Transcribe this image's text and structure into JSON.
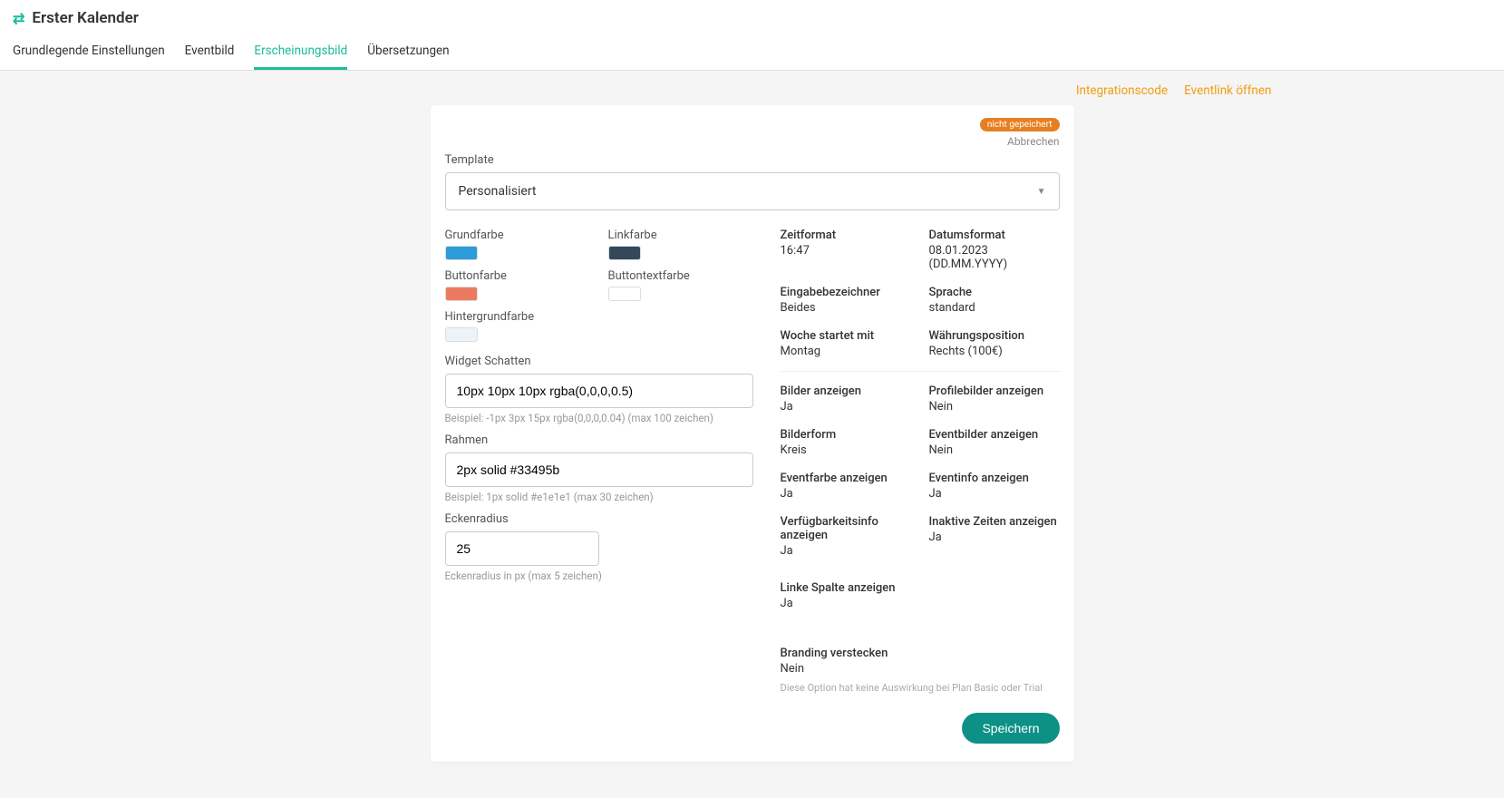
{
  "header": {
    "title": "Erster Kalender"
  },
  "tabs": [
    {
      "label": "Grundlegende Einstellungen",
      "active": false
    },
    {
      "label": "Eventbild",
      "active": false
    },
    {
      "label": "Erscheinungsbild",
      "active": true
    },
    {
      "label": "Übersetzungen",
      "active": false
    }
  ],
  "topLinks": {
    "integration": "Integrationscode",
    "eventlink": "Eventlink öffnen"
  },
  "card": {
    "badge": "nicht gepeichert",
    "cancel": "Abbrechen",
    "templateLabel": "Template",
    "templateValue": "Personalisiert",
    "colors": {
      "grund": {
        "label": "Grundfarbe",
        "hex": "#2D9CDB"
      },
      "link": {
        "label": "Linkfarbe",
        "hex": "#33495b"
      },
      "button": {
        "label": "Buttonfarbe",
        "hex": "#EB7A5E"
      },
      "buttontext": {
        "label": "Buttontextfarbe",
        "hex": "#FFFFFF"
      },
      "hintergrund": {
        "label": "Hintergrundfarbe",
        "hex": "#EDF3F7"
      }
    },
    "widgetShadow": {
      "label": "Widget Schatten",
      "value": "10px 10px 10px rgba(0,0,0,0.5)",
      "hint": "Beispiel: -1px 3px 15px rgba(0,0,0,0.04) (max 100 zeichen)"
    },
    "border": {
      "label": "Rahmen",
      "value": "2px solid #33495b",
      "hint": "Beispiel: 1px solid #e1e1e1 (max 30 zeichen)"
    },
    "radius": {
      "label": "Eckenradius",
      "value": "25",
      "hint": "Eckenradius in px (max 5 zeichen)"
    },
    "settingsA": [
      {
        "label": "Zeitformat",
        "value": "16:47"
      },
      {
        "label": "Datumsformat",
        "value": "08.01.2023 (DD.MM.YYYY)"
      },
      {
        "label": "Eingabebezeichner",
        "value": "Beides"
      },
      {
        "label": "Sprache",
        "value": "standard"
      },
      {
        "label": "Woche startet mit",
        "value": "Montag"
      },
      {
        "label": "Währungsposition",
        "value": "Rechts (100€)"
      }
    ],
    "settingsB": [
      {
        "label": "Bilder anzeigen",
        "value": "Ja"
      },
      {
        "label": "Profilebilder anzeigen",
        "value": "Nein"
      },
      {
        "label": "Bilderform",
        "value": "Kreis"
      },
      {
        "label": "Eventbilder anzeigen",
        "value": "Nein"
      },
      {
        "label": "Eventfarbe anzeigen",
        "value": "Ja"
      },
      {
        "label": "Eventinfo anzeigen",
        "value": "Ja"
      },
      {
        "label": "Verfügbarkeitsinfo anzeigen",
        "value": "Ja"
      },
      {
        "label": "Inaktive Zeiten anzeigen",
        "value": "Ja"
      }
    ],
    "settingsC": [
      {
        "label": "Linke Spalte anzeigen",
        "value": "Ja"
      }
    ],
    "branding": {
      "label": "Branding verstecken",
      "value": "Nein",
      "note": "Diese Option hat keine Auswirkung bei Plan Basic oder Trial"
    },
    "save": "Speichern"
  }
}
